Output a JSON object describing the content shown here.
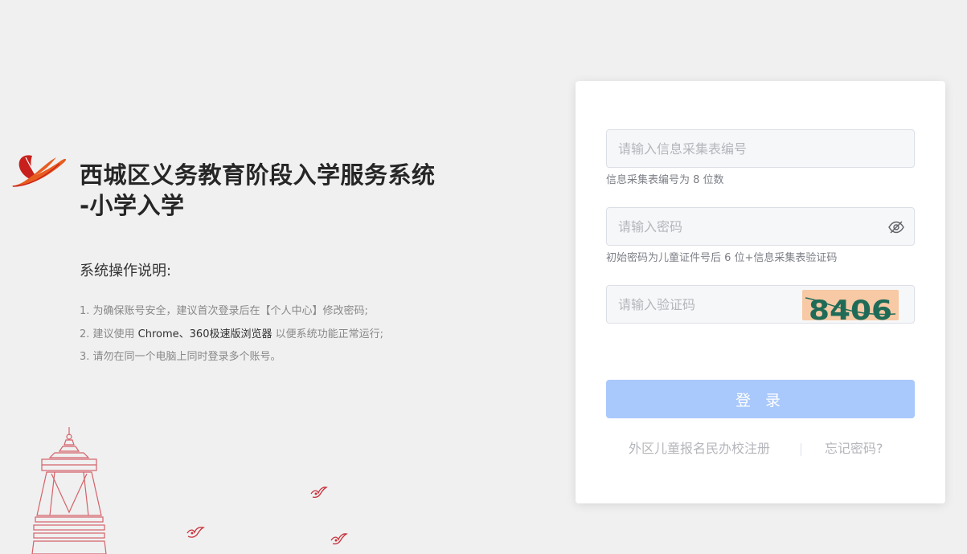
{
  "brand": {
    "title_line1": "西城区义务教育阶段入学服务系统",
    "title_line2": "-小学入学",
    "colors": {
      "logo_red": "#c8201d",
      "logo_orange": "#e85c1f"
    }
  },
  "instructions": {
    "title": "系统操作说明:",
    "item1": "1. 为确保账号安全，建议首次登录后在【个人中心】修改密码;",
    "item2_prefix": "2. 建议使用 ",
    "item2_highlight": "Chrome、360极速版浏览器",
    "item2_suffix": " 以便系统功能正常运行;",
    "item3": "3. 请勿在同一个电脑上同时登录多个账号。"
  },
  "login": {
    "code_no_placeholder": "请输入信息采集表编号",
    "code_no_hint": "信息采集表编号为 8 位数",
    "password_placeholder": "请输入密码",
    "password_hint": "初始密码为儿童证件号后 6 位+信息采集表验证码",
    "captcha_placeholder": "请输入验证码",
    "captcha_text": "8406",
    "submit_label": "登 录",
    "register_link": "外区儿童报名民办校注册",
    "forgot_link": "忘记密码?",
    "eye_icon": "eye-off-icon",
    "colors": {
      "button": "#a9c8fb",
      "captcha_bg": "#f7c9a4",
      "captcha_text": "#1f6b58"
    }
  }
}
